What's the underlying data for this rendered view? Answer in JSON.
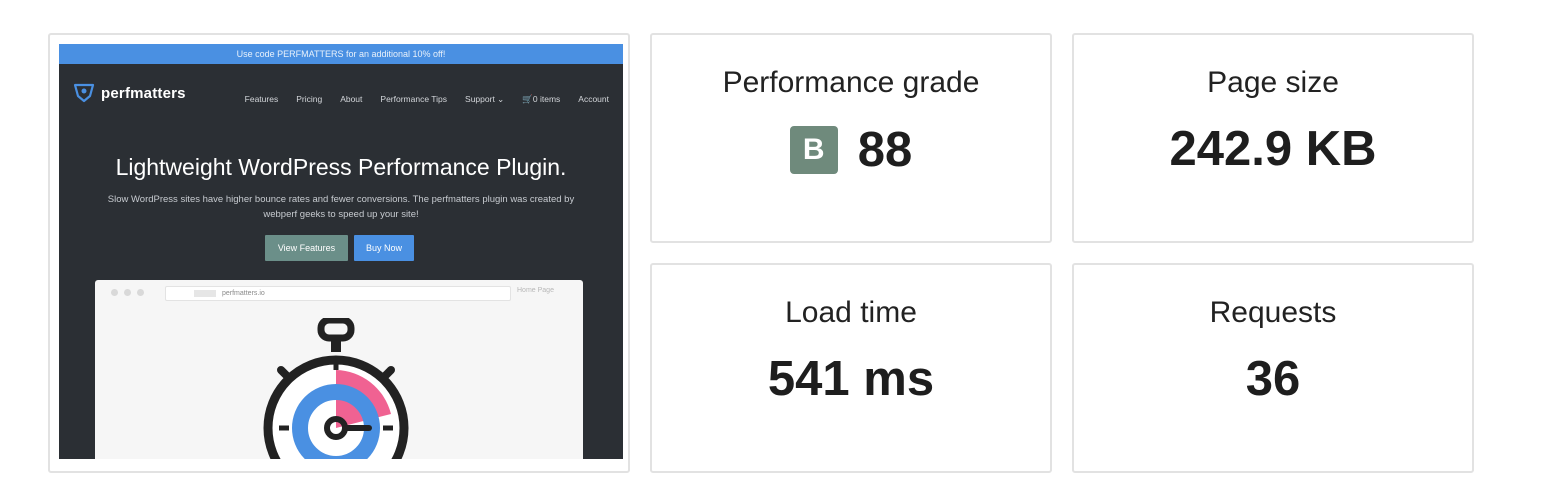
{
  "screenshot": {
    "promo_text": "Use code PERFMATTERS for an additional 10% off!",
    "logo_text": "perfmatters",
    "nav_items": [
      "Features",
      "Pricing",
      "About",
      "Performance Tips",
      "Support ⌄",
      "🛒0 items",
      "Account"
    ],
    "hero_title": "Lightweight WordPress Performance Plugin.",
    "hero_sub_line1": "Slow WordPress sites have higher bounce rates and fewer conversions. The perfmatters plugin was created by",
    "hero_sub_line2": "webperf geeks to speed up your site!",
    "btn_features": "View Features",
    "btn_buy": "Buy Now",
    "mock_url": "perfmatters.io",
    "mock_right": "Home Page"
  },
  "metrics": {
    "grade": {
      "label": "Performance grade",
      "letter": "B",
      "score": "88"
    },
    "size": {
      "label": "Page size",
      "value": "242.9 KB"
    },
    "load": {
      "label": "Load time",
      "value": "541 ms"
    },
    "requests": {
      "label": "Requests",
      "value": "36"
    }
  },
  "colors": {
    "grade_badge": "#6f8a7c",
    "site_bg": "#2b2f34",
    "accent_blue": "#4a90e2",
    "stopwatch_pink": "#f06292"
  }
}
